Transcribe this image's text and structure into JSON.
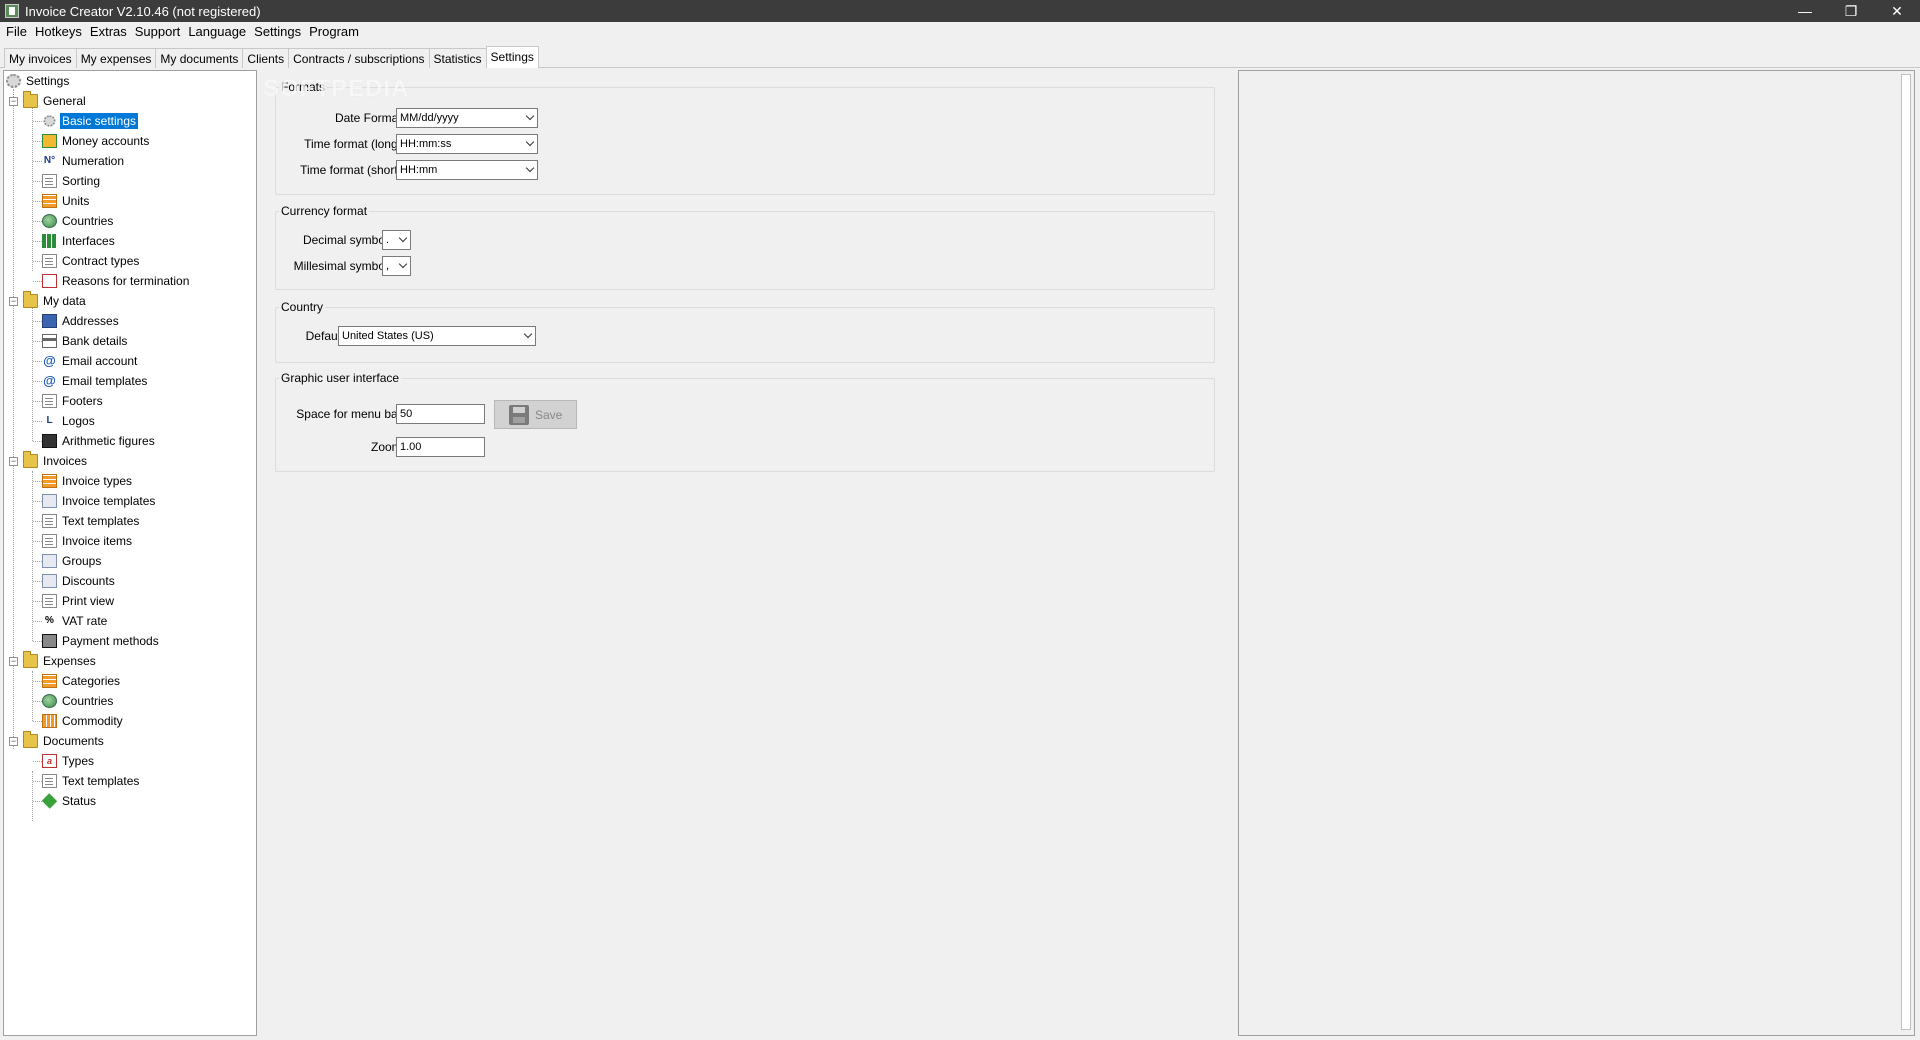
{
  "window": {
    "title": "Invoice Creator V2.10.46 (not registered)",
    "controls": {
      "minimize": "—",
      "restore": "❐",
      "close": "✕"
    }
  },
  "menu": [
    "File",
    "Hotkeys",
    "Extras",
    "Support",
    "Language",
    "Settings",
    "Program"
  ],
  "tabs": [
    "My invoices",
    "My expenses",
    "My documents",
    "Clients",
    "Contracts / subscriptions",
    "Statistics",
    "Settings"
  ],
  "active_tab": "Settings",
  "tree": {
    "root": "Settings",
    "groups": [
      {
        "label": "General",
        "items": [
          "Basic settings",
          "Money accounts",
          "Numeration",
          "Sorting",
          "Units",
          "Countries",
          "Interfaces",
          "Contract types",
          "Reasons for termination"
        ]
      },
      {
        "label": "My data",
        "items": [
          "Addresses",
          "Bank details",
          "Email account",
          "Email templates",
          "Footers",
          "Logos",
          "Arithmetic figures"
        ]
      },
      {
        "label": "Invoices",
        "items": [
          "Invoice types",
          "Invoice templates",
          "Text templates",
          "Invoice items",
          "Groups",
          "Discounts",
          "Print view",
          "VAT rate",
          "Payment methods"
        ]
      },
      {
        "label": "Expenses",
        "items": [
          "Categories",
          "Countries",
          "Commodity"
        ]
      },
      {
        "label": "Documents",
        "items": [
          "Types",
          "Text templates",
          "Status"
        ]
      }
    ],
    "selected": "Basic settings",
    "icon_glyphs": {
      "numeration": "N°",
      "vat": "%",
      "logos": "L",
      "email": "@",
      "types": "a"
    }
  },
  "watermark": "SOFTPEDIA",
  "formats": {
    "title": "Formats",
    "date_label": "Date Format:",
    "date_value": "MM/dd/yyyy",
    "time_long_label": "Time format (long):",
    "time_long_value": "HH:mm:ss",
    "time_short_label": "Time format (short):",
    "time_short_value": "HH:mm"
  },
  "currency": {
    "title": "Currency format",
    "decimal_label": "Decimal symbol:",
    "decimal_value": ".",
    "millesimal_label": "Millesimal symbol:",
    "millesimal_value": ","
  },
  "country": {
    "title": "Country",
    "default_label": "Default:",
    "default_value": "United States (US)"
  },
  "gui": {
    "title": "Graphic user interface",
    "menu_space_label": "Space for menu bar:",
    "menu_space_value": "50",
    "save_label": "Save",
    "zoom_label": "Zoom:",
    "zoom_value": "1.00"
  }
}
